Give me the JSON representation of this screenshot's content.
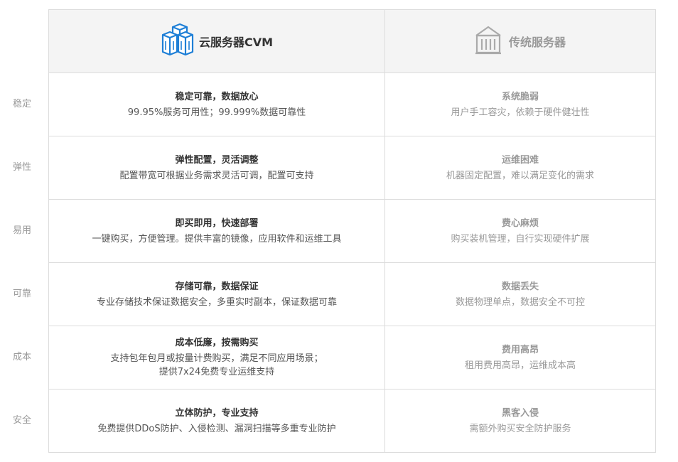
{
  "header": {
    "cvm_title": "云服务器CVM",
    "cvm_icon": "server-cubes-icon",
    "traditional_title": "传统服务器",
    "traditional_icon": "building-icon"
  },
  "rows": [
    {
      "label": "稳定",
      "cvm_title": "稳定可靠，数据放心",
      "cvm_desc": [
        "99.95%服务可用性；99.999%数据可靠性"
      ],
      "traditional_title": "系统脆弱",
      "traditional_desc": "用户手工容灾，依赖于硬件健壮性"
    },
    {
      "label": "弹性",
      "cvm_title": "弹性配置，灵活调整",
      "cvm_desc": [
        "配置带宽可根据业务需求灵活可调，配置可支持"
      ],
      "traditional_title": "运维困难",
      "traditional_desc": "机器固定配置，难以满足变化的需求"
    },
    {
      "label": "易用",
      "cvm_title": "即买即用，快速部署",
      "cvm_desc": [
        "一键购买，方便管理。提供丰富的镜像，应用软件和运维工具"
      ],
      "traditional_title": "费心麻烦",
      "traditional_desc": "购买装机管理，自行实现硬件扩展"
    },
    {
      "label": "可靠",
      "cvm_title": "存储可靠，数据保证",
      "cvm_desc": [
        "专业存储技术保证数据安全，多重实时副本，保证数据可靠"
      ],
      "traditional_title": "数据丢失",
      "traditional_desc": "数据物理单点，数据安全不可控"
    },
    {
      "label": "成本",
      "cvm_title": "成本低廉，按需购买",
      "cvm_desc": [
        "支持包年包月或按量计费购买，满足不同应用场景；",
        "提供7x24免费专业运维支持"
      ],
      "traditional_title": "费用高昂",
      "traditional_desc": "租用费用高昂，运维成本高"
    },
    {
      "label": "安全",
      "cvm_title": "立体防护，专业支持",
      "cvm_desc": [
        "免费提供DDoS防护、入侵检测、漏洞扫描等多重专业防护"
      ],
      "traditional_title": "黑客入侵",
      "traditional_desc": "需额外购买安全防护服务"
    }
  ],
  "colors": {
    "cvm_icon_blue": "#1e7fd6",
    "traditional_icon_gray": "#aaaaaa",
    "header_bg": "#f4f4f4",
    "border": "#dcdcdc"
  }
}
